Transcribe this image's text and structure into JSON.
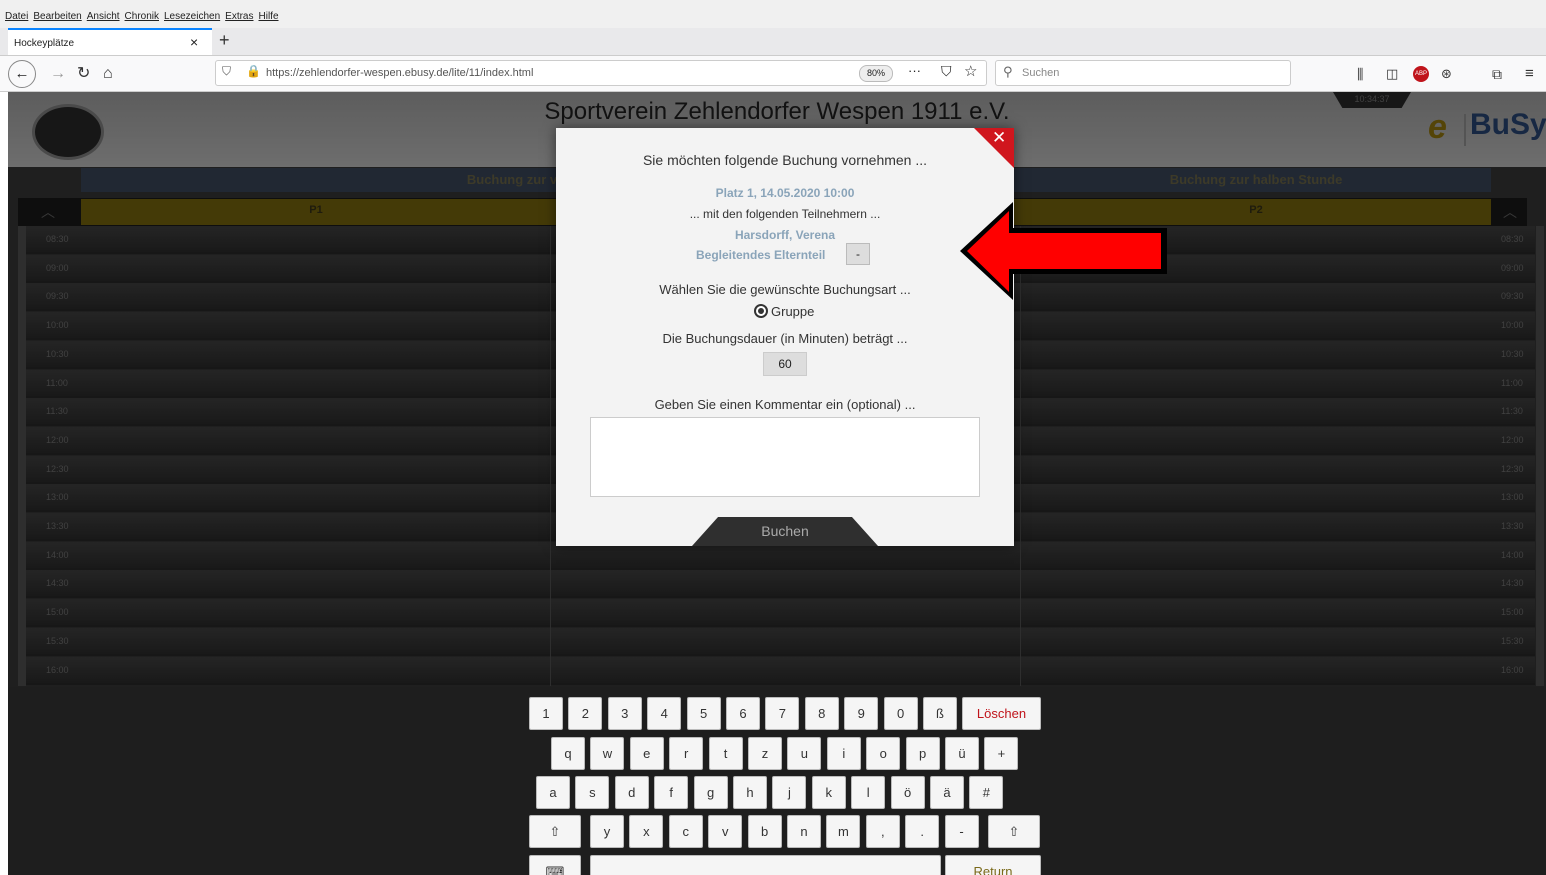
{
  "menu": [
    "Datei",
    "Bearbeiten",
    "Ansicht",
    "Chronik",
    "Lesezeichen",
    "Extras",
    "Hilfe"
  ],
  "tab": {
    "title": "Hockeyplätze",
    "close": "×",
    "new": "+"
  },
  "nav": {
    "url": "https://zehlendorfer-wespen.ebusy.de/lite/11/index.html",
    "zoom": "80%",
    "search_placeholder": "Suchen",
    "more": "···"
  },
  "app": {
    "title": "Sportverein Zehlendorfer Wespen 1911 e.V.",
    "clock": "10:34:37",
    "logo_e": "e",
    "logo_busy": "BuSy",
    "header_left": "Buchung zur vollen Stunde",
    "header_right": "Buchung zur halben Stunde",
    "col_p1": "P1",
    "col_p2": "P2",
    "times": [
      "08:30",
      "09:00",
      "09:30",
      "10:00",
      "10:30",
      "11:00",
      "11:30",
      "12:00",
      "12:30",
      "13:00",
      "13:30",
      "14:00",
      "14:30",
      "15:00",
      "15:30",
      "16:00"
    ]
  },
  "modal": {
    "heading": "Sie möchten folgende Buchung vornehmen ...",
    "slot": "Platz 1, 14.05.2020 10:00",
    "participants_label": "... mit den folgenden Teilnehmern ...",
    "participant": "Harsdorff, Verena",
    "companion": "Begleitendes Elternteil",
    "companion_btn": "-",
    "type_label": "Wählen Sie die gewünschte Buchungsart ...",
    "type_option": "Gruppe",
    "duration_label": "Die Buchungsdauer (in Minuten) beträgt ...",
    "duration": "60",
    "comment_label": "Geben Sie einen Kommentar ein (optional) ...",
    "submit": "Buchen",
    "close": "✕"
  },
  "keyboard": {
    "row1": [
      "1",
      "2",
      "3",
      "4",
      "5",
      "6",
      "7",
      "8",
      "9",
      "0",
      "ß"
    ],
    "delete": "Löschen",
    "row2": [
      "q",
      "w",
      "e",
      "r",
      "t",
      "z",
      "u",
      "i",
      "o",
      "p",
      "ü",
      "+"
    ],
    "row3": [
      "a",
      "s",
      "d",
      "f",
      "g",
      "h",
      "j",
      "k",
      "l",
      "ö",
      "ä",
      "#"
    ],
    "row4": [
      "⇧",
      "y",
      "x",
      "c",
      "v",
      "b",
      "n",
      "m",
      ",",
      ".",
      "-",
      "⇧"
    ],
    "return": "Return"
  },
  "colors": {
    "accent": "#0a84ff",
    "gold": "#a8880d",
    "close_red": "#d0161e",
    "arrow_red": "#ff0000",
    "delete_red": "#c0141b"
  }
}
